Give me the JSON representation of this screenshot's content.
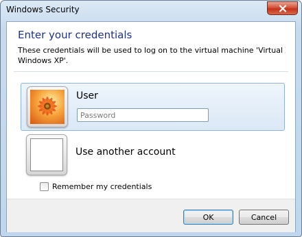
{
  "window": {
    "title": "Windows Security"
  },
  "dialog": {
    "heading": "Enter your credentials",
    "description": "These credentials will be used to log on to the virtual machine 'Virtual Windows XP'."
  },
  "accounts": [
    {
      "name": "User",
      "avatar": "orange-flower-picture",
      "password_placeholder": "Password",
      "password_value": ""
    },
    {
      "name": "Use another account",
      "avatar": "blank-picture"
    }
  ],
  "remember": {
    "label": "Remember my credentials",
    "checked": false
  },
  "buttons": {
    "ok": "OK",
    "cancel": "Cancel"
  },
  "colors": {
    "heading": "#1e3287",
    "selected_tile": "#dbe8f6",
    "close_button": "#c4321a"
  }
}
